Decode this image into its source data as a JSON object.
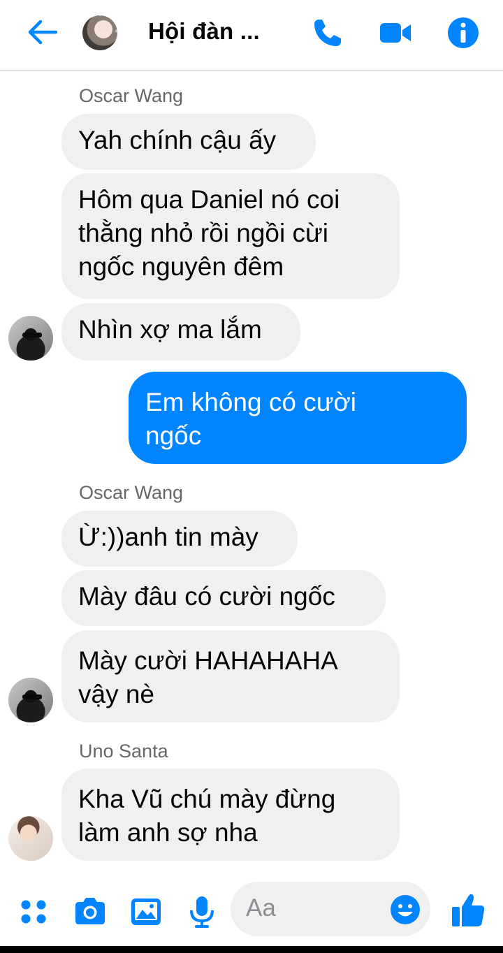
{
  "header": {
    "title": "Hội đàn ..."
  },
  "senders": {
    "s1": "Oscar Wang",
    "s2": "Oscar Wang",
    "s3": "Uno Santa"
  },
  "messages": {
    "m1": "Yah chính cậu ấy",
    "m2": "Hôm qua Daniel nó coi\nthằng nhỏ rồi ngồi cừi\nngốc nguyên đêm",
    "m3": "Nhìn xợ ma lắm",
    "m4": "Em không có cười\nngốc",
    "m5": "Ừ:))anh tin mày",
    "m6": "Mày đâu có cười ngốc",
    "m7": "Mày cười HAHAHAHA\nvậy nè",
    "m8": "Kha Vũ chú mày đừng\nlàm anh sợ nha"
  },
  "composer": {
    "placeholder": "Aa"
  },
  "colors": {
    "accent": "#0084ff",
    "bubble_in": "#f0f0f0",
    "meta_text": "#65676b"
  },
  "icons": [
    "back-arrow-icon",
    "phone-icon",
    "video-camera-icon",
    "info-icon",
    "apps-icon",
    "camera-icon",
    "image-icon",
    "microphone-icon",
    "emoji-icon",
    "thumbs-up-icon"
  ]
}
